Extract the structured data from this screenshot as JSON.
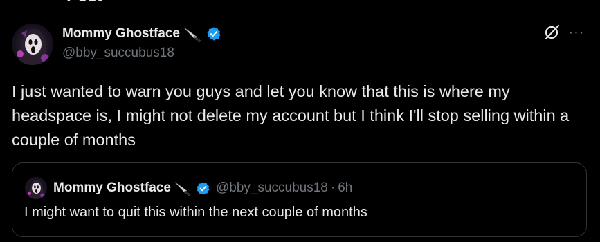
{
  "header": {
    "title": "Post"
  },
  "author": {
    "display_name": "Mommy Ghostface",
    "handle": "@bby_succubus18",
    "name_emoji_icon": "knife-icon",
    "verified_icon": "verified-badge-icon"
  },
  "actions": {
    "grok_icon": "grok-icon",
    "more_label": "···"
  },
  "post": {
    "text": "I just wanted to warn you guys and let you know that this is where my headspace is, I might not delete my account but I think I'll stop selling within a couple of months"
  },
  "quote": {
    "display_name": "Mommy Ghostface",
    "handle": "@bby_succubus18",
    "separator": "·",
    "time": "6h",
    "text": "I might want to quit this within the next couple of months"
  },
  "colors": {
    "background": "#000000",
    "text_primary": "#e7e9ea",
    "text_secondary": "#71767b",
    "verified": "#1d9bf0",
    "border": "#2f3336"
  }
}
